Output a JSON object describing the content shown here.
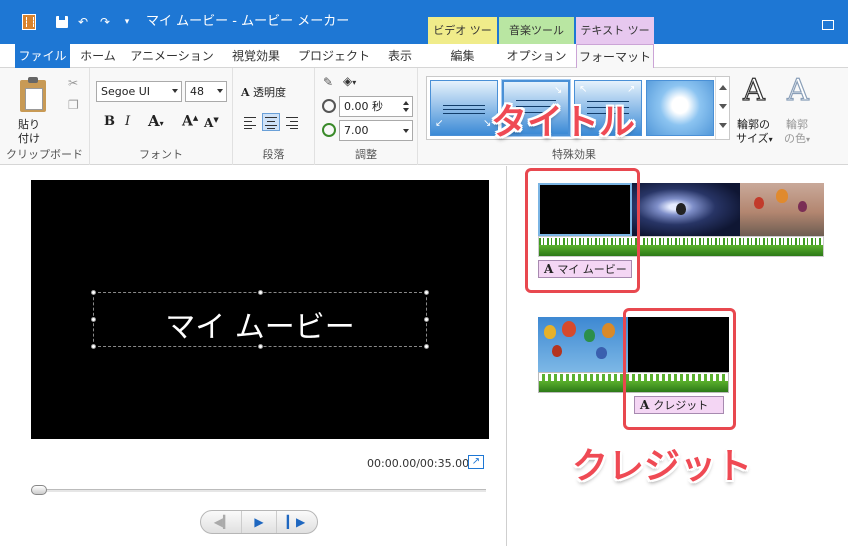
{
  "window": {
    "title": "マイ ムービー - ムービー メーカー",
    "context_tabs": [
      "ビデオ ツール",
      "音楽ツール",
      "テキスト ツール"
    ]
  },
  "tabs": {
    "file": "ファイル",
    "home": "ホーム",
    "animation": "アニメーション",
    "visual_effects": "視覚効果",
    "project": "プロジェクト",
    "view": "表示",
    "edit": "編集",
    "options": "オプション",
    "format": "フォーマット"
  },
  "ribbon": {
    "clipboard": {
      "label": "クリップボード",
      "paste_line1": "貼り",
      "paste_line2": "付け"
    },
    "font": {
      "label": "フォント",
      "font_name": "Segoe UI",
      "font_size": "48"
    },
    "paragraph": {
      "label": "段落",
      "transparency": "透明度"
    },
    "adjust": {
      "label": "調整",
      "start_time": "0.00 秒",
      "duration": "7.00"
    },
    "special_effects": {
      "label": "特殊効果"
    },
    "outline_size": {
      "line1": "輪郭の",
      "line2": "サイズ"
    },
    "outline_color": {
      "line1": "輪郭",
      "line2": "の色"
    }
  },
  "preview": {
    "text": "マイ ムービー",
    "timecode": "00:00.00/00:35.00",
    "progress": 0
  },
  "timeline": {
    "title_caption": "マイ ムービー",
    "credit_caption": "クレジット",
    "caption_glyph": "A"
  },
  "annotations": {
    "title_callout": "タイトル",
    "credit_callout": "クレジット"
  },
  "colors": {
    "title_bar": "#1e77d4",
    "callout": "#ef4a54",
    "video_tools": "#f0ec8a",
    "music_tools": "#b9e6a2",
    "text_tools": "#e7c8ef"
  }
}
